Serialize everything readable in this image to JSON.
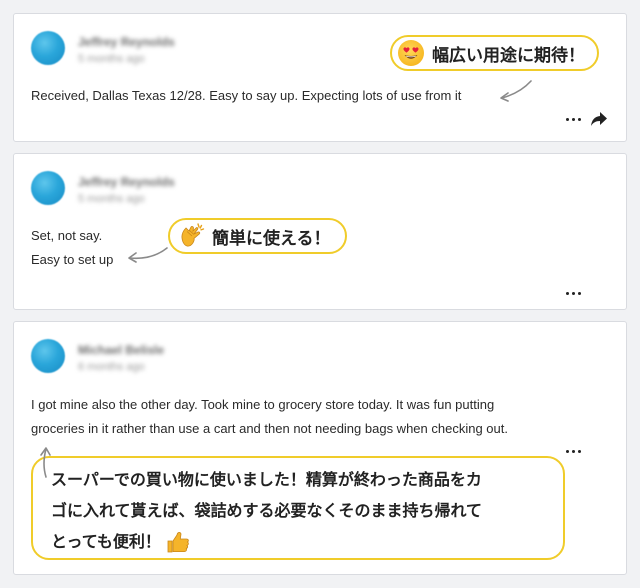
{
  "reviews": [
    {
      "author": "Jeffrey Reynolds",
      "date": "5 months ago",
      "text_lines": [
        "Received, Dallas Texas 12/28. Easy to say up. Expecting lots of use from it"
      ],
      "callout": "幅広い用途に期待！",
      "callout_emoji": "heart-eyes-emoji-icon"
    },
    {
      "author": "Jeffrey Reynolds",
      "date": "5 months ago",
      "text_lines": [
        "Set, not say.",
        "Easy to set up"
      ],
      "callout": "簡単に使える！",
      "callout_emoji": "clapping-hands-emoji-icon"
    },
    {
      "author": "Michael Belisle",
      "date": "6 months ago",
      "text_lines": [
        "I got mine also the other day. Took mine to grocery store today. It was fun putting",
        "groceries in it rather than use a cart and then not needing bags when checking out."
      ],
      "callout_lines": [
        "スーパーでの買い物に使いました！精算が終わった商品をカ",
        "ゴに入れて貰えば、袋詰めする必要なくそのまま持ち帰れて",
        "とっても便利！"
      ],
      "callout_emoji": "thumbs-up-emoji-icon"
    }
  ],
  "colors": {
    "callout_border": "#f0cc2a",
    "avatar": "#2aa6da",
    "page_bg": "#f1f2f4"
  }
}
